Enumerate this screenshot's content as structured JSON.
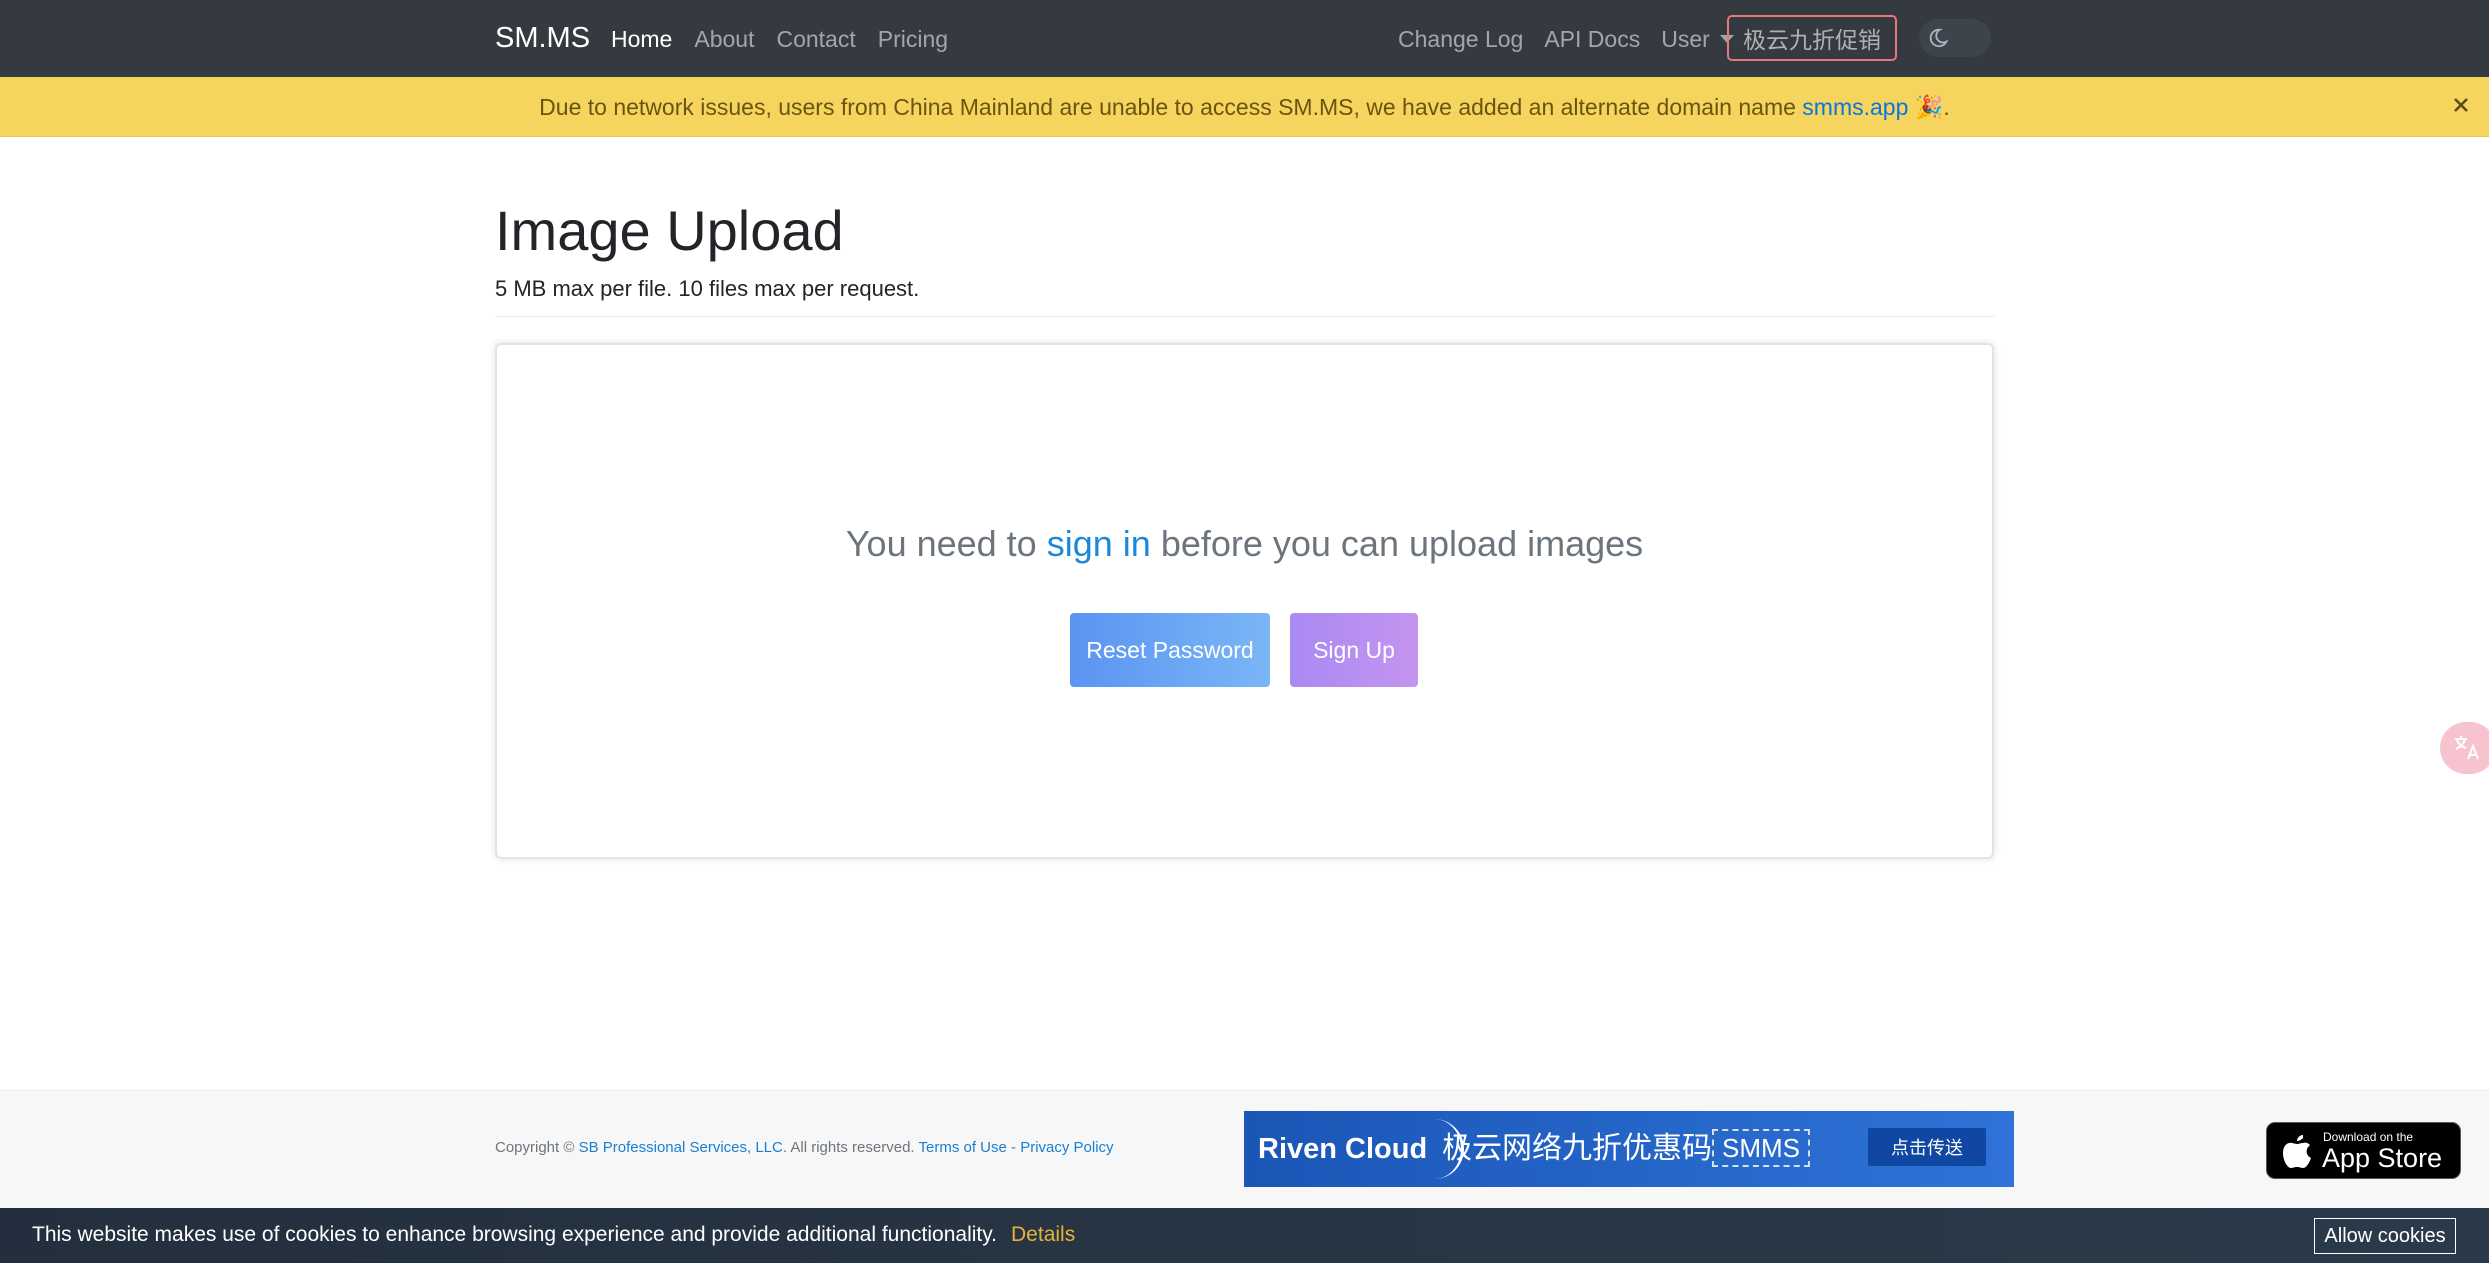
{
  "navbar": {
    "brand": "SM.MS",
    "left_links": [
      "Home",
      "About",
      "Contact",
      "Pricing"
    ],
    "right_links": [
      "Change Log",
      "API Docs"
    ],
    "user_label": "User",
    "promo_label": "极云九折促销"
  },
  "alert": {
    "message": "Due to network issues, users from China Mainland are unable to access SM.MS, we have added an alternate domain name",
    "domain_link": "smms.app",
    "emoji": "🎉",
    "trailing": "."
  },
  "main": {
    "title": "Image Upload",
    "subtitle": "5 MB max per file. 10 files max per request.",
    "upload": {
      "prefix": "You need to",
      "signin_link": "sign in",
      "suffix": "before you can upload images",
      "reset_button": "Reset Password",
      "signup_button": "Sign Up"
    }
  },
  "footer": {
    "copyright_prefix": "Copyright ©",
    "company_link": "SB Professional Services, LLC",
    "rights": ". All rights reserved.",
    "terms_link": "Terms of Use",
    "separator": "-",
    "privacy_link": "Privacy Policy",
    "ad": {
      "brand": "Riven Cloud",
      "text": "极云网络九折优惠码",
      "code": "SMMS",
      "button": "点击传送"
    },
    "appstore": {
      "small": "Download on the",
      "big": "App Store"
    }
  },
  "cookie": {
    "message": "This website makes use of cookies to enhance browsing experience and provide additional functionality.",
    "details_link": "Details",
    "allow_button": "Allow cookies"
  },
  "colors": {
    "navbar_bg": "#343a40",
    "alert_bg": "#f5d55e",
    "link": "#1a8ad8",
    "promo_border": "#e8767d"
  }
}
